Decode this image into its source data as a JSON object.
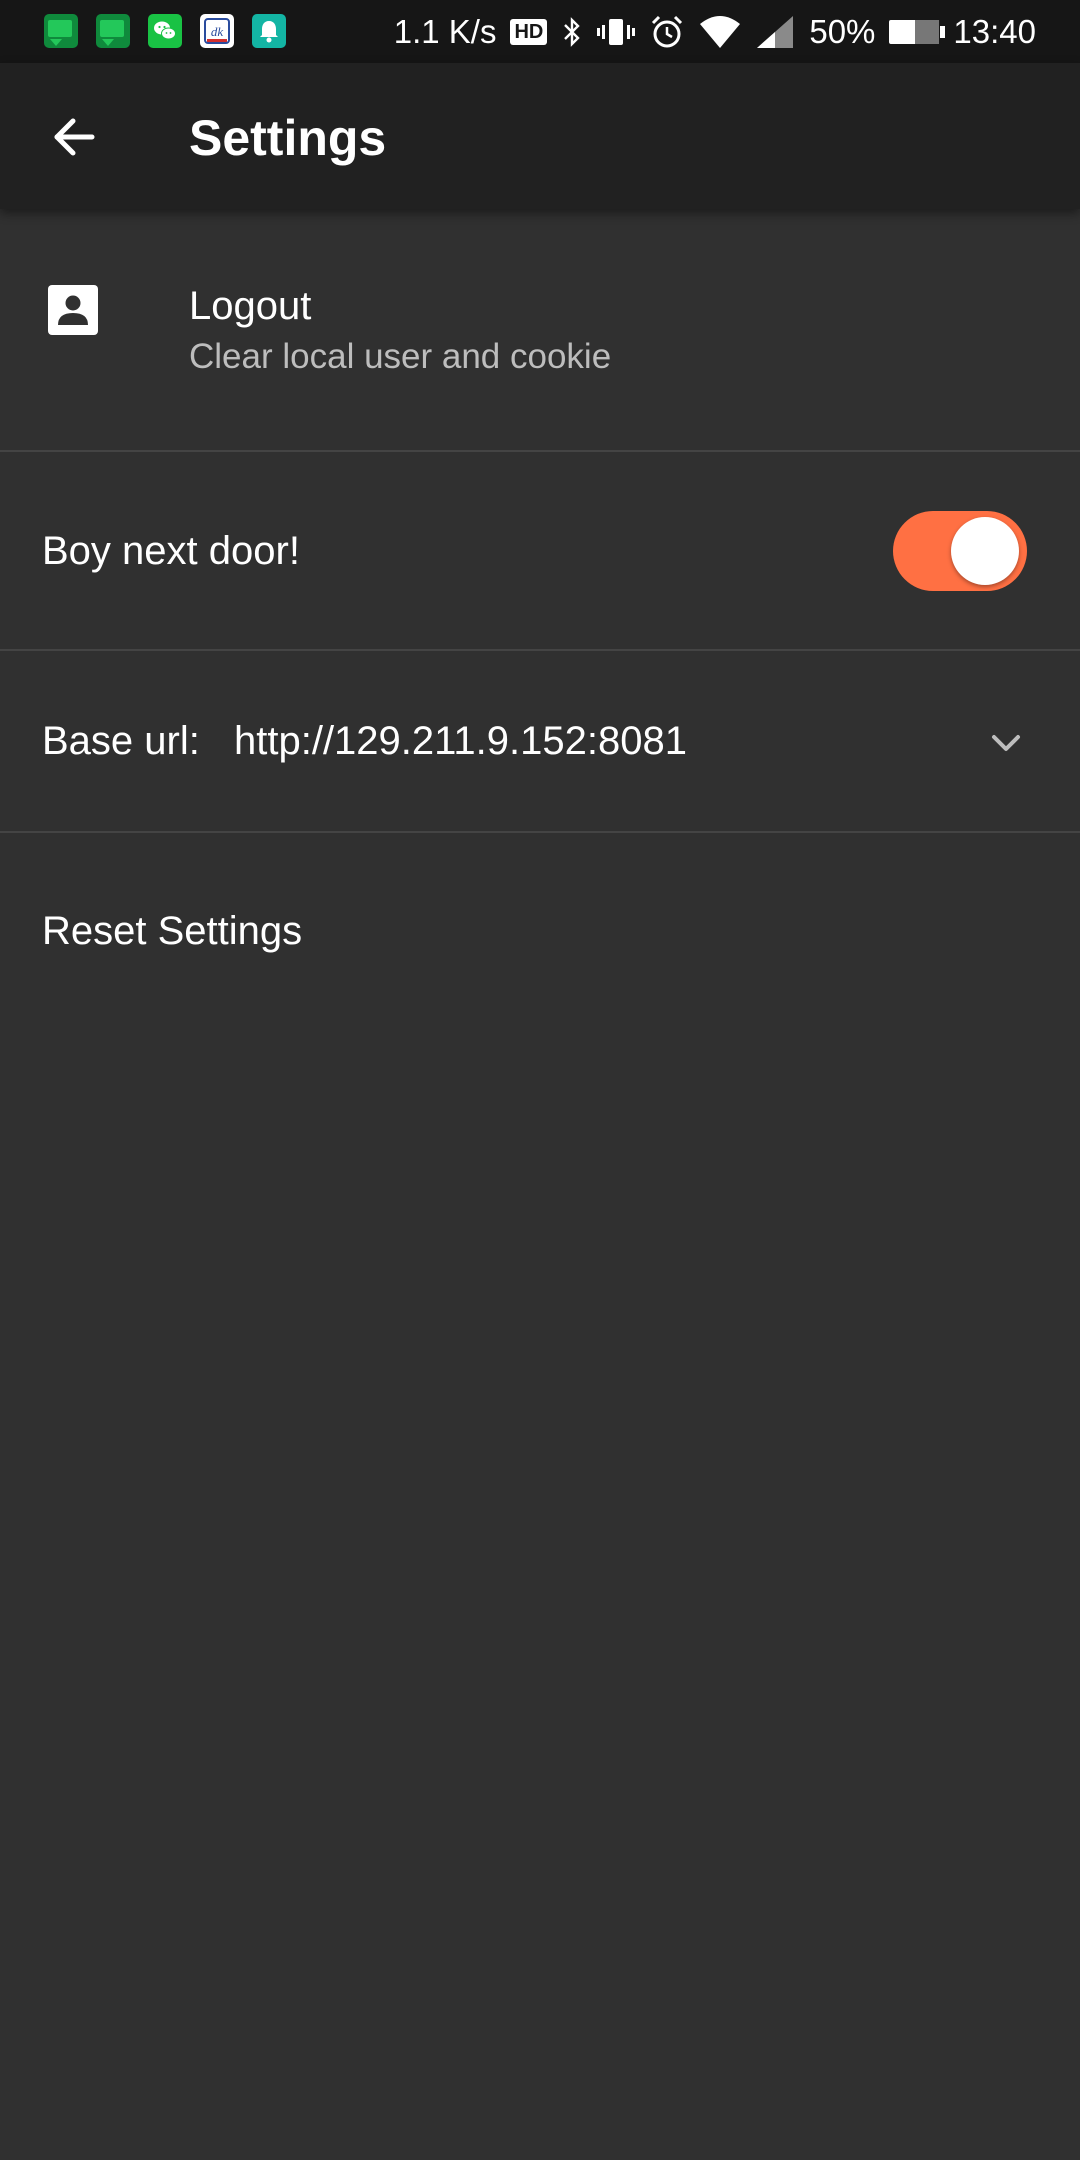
{
  "status_bar": {
    "network_speed": "1.1 K/s",
    "hd_label": "HD",
    "battery_percent": "50%",
    "battery_level": 0.5,
    "time": "13:40",
    "notification_icons": [
      "chat-icon",
      "chat-icon",
      "wechat-icon",
      "news-icon",
      "bell-icon"
    ]
  },
  "app_bar": {
    "title": "Settings",
    "back_icon": "arrow-back-icon"
  },
  "settings": {
    "logout": {
      "title": "Logout",
      "subtitle": "Clear local user and cookie",
      "icon": "account-box-icon"
    },
    "boy_next_door": {
      "label": "Boy next door!",
      "enabled": true
    },
    "base_url": {
      "label": "Base url:",
      "value": "http://129.211.9.152:8081",
      "icon": "chevron-down-icon"
    },
    "reset": {
      "label": "Reset Settings"
    }
  },
  "colors": {
    "background": "#303030",
    "app_bar": "#212121",
    "status_bar": "#161616",
    "accent": "#ff7043",
    "divider": "#444444",
    "secondary_text": "#bdbdbd"
  }
}
